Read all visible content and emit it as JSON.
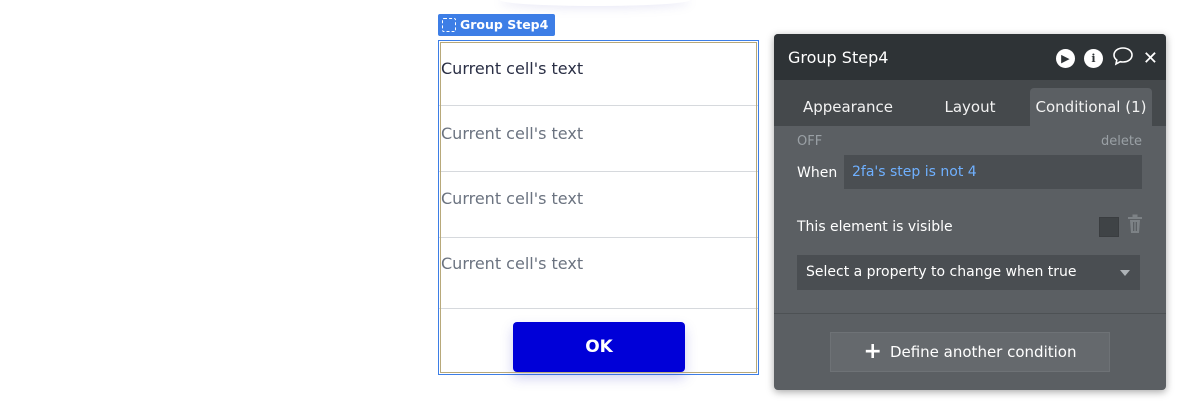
{
  "canvas": {
    "group_tag": "Group Step4",
    "cells": [
      "Current cell's text",
      "Current cell's text",
      "Current cell's text",
      "Current cell's text"
    ],
    "ok_button": "OK"
  },
  "panel": {
    "title": "Group Step4",
    "header_icons": [
      "play-icon",
      "info-icon",
      "comment-icon",
      "close-icon"
    ],
    "tabs": [
      "Appearance",
      "Layout",
      "Conditional (1)"
    ],
    "active_tab": "Conditional (1)",
    "condition": {
      "status": "OFF",
      "delete_label": "delete",
      "when_label": "When",
      "when_expression": "2fa's step is not 4",
      "visible_label": "This element is visible",
      "property_select": "Select a property to change when true"
    },
    "define_another": "Define another condition"
  },
  "colors": {
    "accent_blue": "#3d7ee6",
    "ok_button": "#0000d8",
    "panel_bg": "#5b5f63",
    "panel_header": "#2e3336",
    "expression_text": "#6fb0ff"
  }
}
